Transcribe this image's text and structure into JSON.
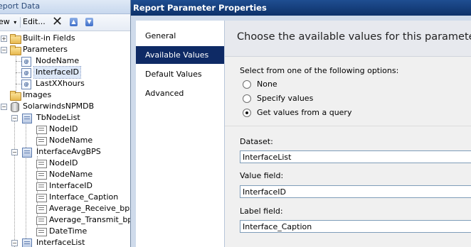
{
  "report_data": {
    "title": "eport Data",
    "toolbar": {
      "new_label": "ew",
      "edit_label": "Edit..."
    },
    "tree": {
      "built_in_fields": "Built-in Fields",
      "parameters": {
        "label": "Parameters",
        "items": [
          "NodeName",
          "InterfaceID",
          "LastXXhours"
        ]
      },
      "images": "Images",
      "data_source": "SolarwindsNPMDB",
      "datasets": [
        {
          "label": "TbNodeList",
          "fields": [
            "NodeID",
            "NodeName"
          ]
        },
        {
          "label": "InterfaceAvgBPS",
          "fields": [
            "NodeID",
            "NodeName",
            "InterfaceID",
            "Interface_Caption",
            "Average_Receive_bps",
            "Average_Transmit_bps",
            "DateTime"
          ]
        },
        {
          "label": "InterfaceList",
          "fields": []
        }
      ]
    }
  },
  "dialog": {
    "title": "Report Parameter Properties",
    "nav": [
      "General",
      "Available Values",
      "Default Values",
      "Advanced"
    ],
    "active_nav": "Available Values",
    "heading": "Choose the available values for this parameter.",
    "options_label": "Select from one of the following options:",
    "options": [
      {
        "label": "None",
        "checked": false
      },
      {
        "label": "Specify values",
        "checked": false
      },
      {
        "label": "Get values from a query",
        "checked": true
      }
    ],
    "dataset": {
      "label": "Dataset:",
      "value": "InterfaceList"
    },
    "value_field": {
      "label": "Value field:",
      "value": "InterfaceID"
    },
    "label_field": {
      "label": "Label field:",
      "value": "Interface_Caption"
    }
  }
}
